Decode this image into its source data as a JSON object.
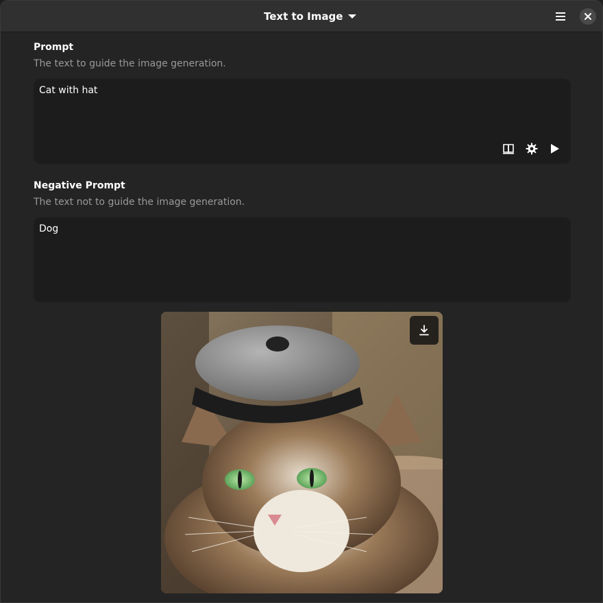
{
  "window": {
    "title": "Text to Image"
  },
  "icons": {
    "dropdown": "caret-down-icon",
    "menu": "hamburger-menu-icon",
    "close": "close-icon",
    "library": "book-icon",
    "settings": "gear-icon",
    "run": "play-icon",
    "download": "download-icon"
  },
  "prompt": {
    "label": "Prompt",
    "description": "The text to guide the image generation.",
    "value": "Cat with hat"
  },
  "negative_prompt": {
    "label": "Negative Prompt",
    "description": "The text not to guide the image generation.",
    "value": "Dog"
  },
  "colors": {
    "background": "#242424",
    "headerbar": "#303030",
    "field": "#1c1c1c",
    "muted_text": "#9a9a9a"
  }
}
